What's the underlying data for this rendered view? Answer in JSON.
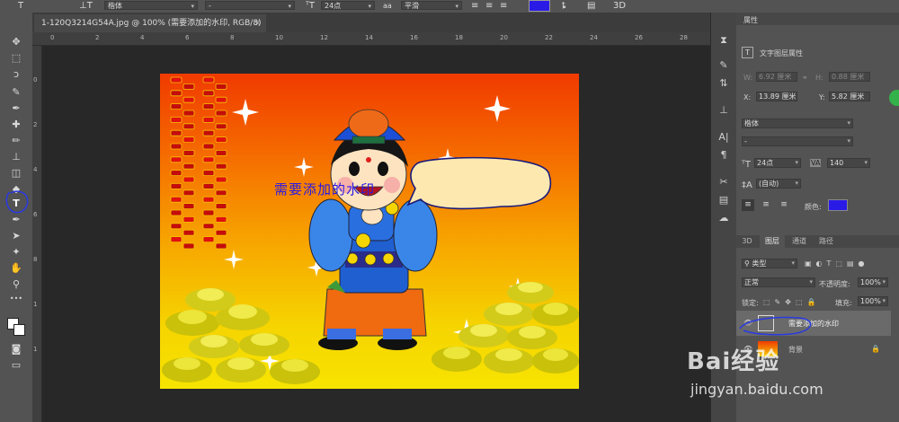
{
  "options_bar": {
    "font_family": "楷体",
    "font_style": "-",
    "font_size": "24点",
    "antialias": "平滑",
    "text_color": "#2a1ae6",
    "label_3d": "3D"
  },
  "document": {
    "tab_title": "1-120Q3214G54A.jpg @ 100% (需要添加的水印, RGB/8) *",
    "ruler_h_ticks": [
      "0",
      "2",
      "4",
      "6",
      "8",
      "10",
      "12",
      "14",
      "16",
      "18",
      "20",
      "22",
      "24",
      "26",
      "28"
    ],
    "ruler_v_ticks": [
      "0",
      "2",
      "4",
      "6",
      "8",
      "1",
      "1"
    ],
    "watermark_text": "需要添加的水印"
  },
  "tools": [
    {
      "name": "move-tool",
      "glyph": "✥"
    },
    {
      "name": "marquee-tool",
      "glyph": "⬚"
    },
    {
      "name": "lasso-tool",
      "glyph": "➰"
    },
    {
      "name": "quick-select-tool",
      "glyph": "✎"
    },
    {
      "name": "eyedropper-tool",
      "glyph": "✒"
    },
    {
      "name": "healing-brush-tool",
      "glyph": "✚"
    },
    {
      "name": "brush-tool",
      "glyph": "✏"
    },
    {
      "name": "clone-stamp-tool",
      "glyph": "⊥"
    },
    {
      "name": "eraser-tool",
      "glyph": "◫"
    },
    {
      "name": "paint-bucket-tool",
      "glyph": "◆"
    },
    {
      "name": "type-tool",
      "glyph": "T"
    },
    {
      "name": "pen-tool",
      "glyph": "✒"
    },
    {
      "name": "path-select-tool",
      "glyph": "➤"
    },
    {
      "name": "shape-tool",
      "glyph": "✦"
    },
    {
      "name": "hand-tool",
      "glyph": "✋"
    },
    {
      "name": "zoom-tool",
      "glyph": "⚲"
    },
    {
      "name": "more-tools",
      "glyph": "•••"
    },
    {
      "name": "color-swatches",
      "glyph": ""
    },
    {
      "name": "quick-mask",
      "glyph": "◙"
    },
    {
      "name": "screen-mode",
      "glyph": "▭"
    }
  ],
  "properties": {
    "panel_title": "属性",
    "section_title": "文字图层属性",
    "w_label": "W:",
    "w_value": "6.92 厘米",
    "h_label": "H:",
    "h_value": "0.88 厘米",
    "x_label": "X:",
    "x_value": "13.89 厘米",
    "y_label": "Y:",
    "y_value": "5.82 厘米",
    "font_family": "楷体",
    "font_style": "-",
    "font_size": "24点",
    "tracking": "140",
    "leading": "(自动)",
    "color_label": "颜色:",
    "color": "#2a1ae6"
  },
  "layers": {
    "tabs": [
      "3D",
      "图层",
      "通道",
      "路径"
    ],
    "filter_kind": "类型",
    "blend_mode": "正常",
    "opacity_label": "不透明度:",
    "opacity": "100%",
    "lock_label": "锁定:",
    "fill_label": "填充:",
    "fill": "100%",
    "items": [
      {
        "name": "需要添加的水印",
        "type": "text"
      },
      {
        "name": "背景",
        "type": "image"
      }
    ]
  },
  "watermark_site": {
    "logo": "Bai经验",
    "url": "jingyan.baidu.com"
  }
}
